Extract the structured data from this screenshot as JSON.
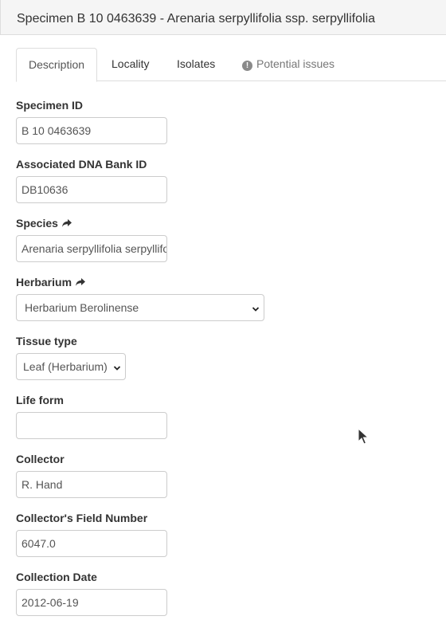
{
  "header": {
    "title": "Specimen B 10 0463639 - Arenaria serpyllifolia ssp. serpyllifolia"
  },
  "tabs": [
    {
      "label": "Description",
      "active": true
    },
    {
      "label": "Locality",
      "active": false
    },
    {
      "label": "Isolates",
      "active": false
    },
    {
      "label": "Potential issues",
      "active": false,
      "icon": "exclamation-circle-icon"
    }
  ],
  "form": {
    "specimen_id": {
      "label": "Specimen ID",
      "value": "B 10 0463639"
    },
    "dna_bank_id": {
      "label": "Associated DNA Bank ID",
      "value": "DB10636"
    },
    "species": {
      "label": "Species",
      "value": "Arenaria serpyllifolia serpyllifolia",
      "icon": "share-arrow-icon"
    },
    "herbarium": {
      "label": "Herbarium",
      "value": "Herbarium Berolinense",
      "icon": "share-arrow-icon"
    },
    "tissue_type": {
      "label": "Tissue type",
      "value": "Leaf (Herbarium)"
    },
    "life_form": {
      "label": "Life form",
      "value": ""
    },
    "collector": {
      "label": "Collector",
      "value": "R. Hand"
    },
    "field_number": {
      "label": "Collector's Field Number",
      "value": "6047.0"
    },
    "collection_date": {
      "label": "Collection Date",
      "value": "2012-06-19"
    }
  },
  "colors": {
    "heading_bg": "#f5f5f5",
    "border": "#dddddd",
    "text": "#333333",
    "input_text": "#555555"
  }
}
